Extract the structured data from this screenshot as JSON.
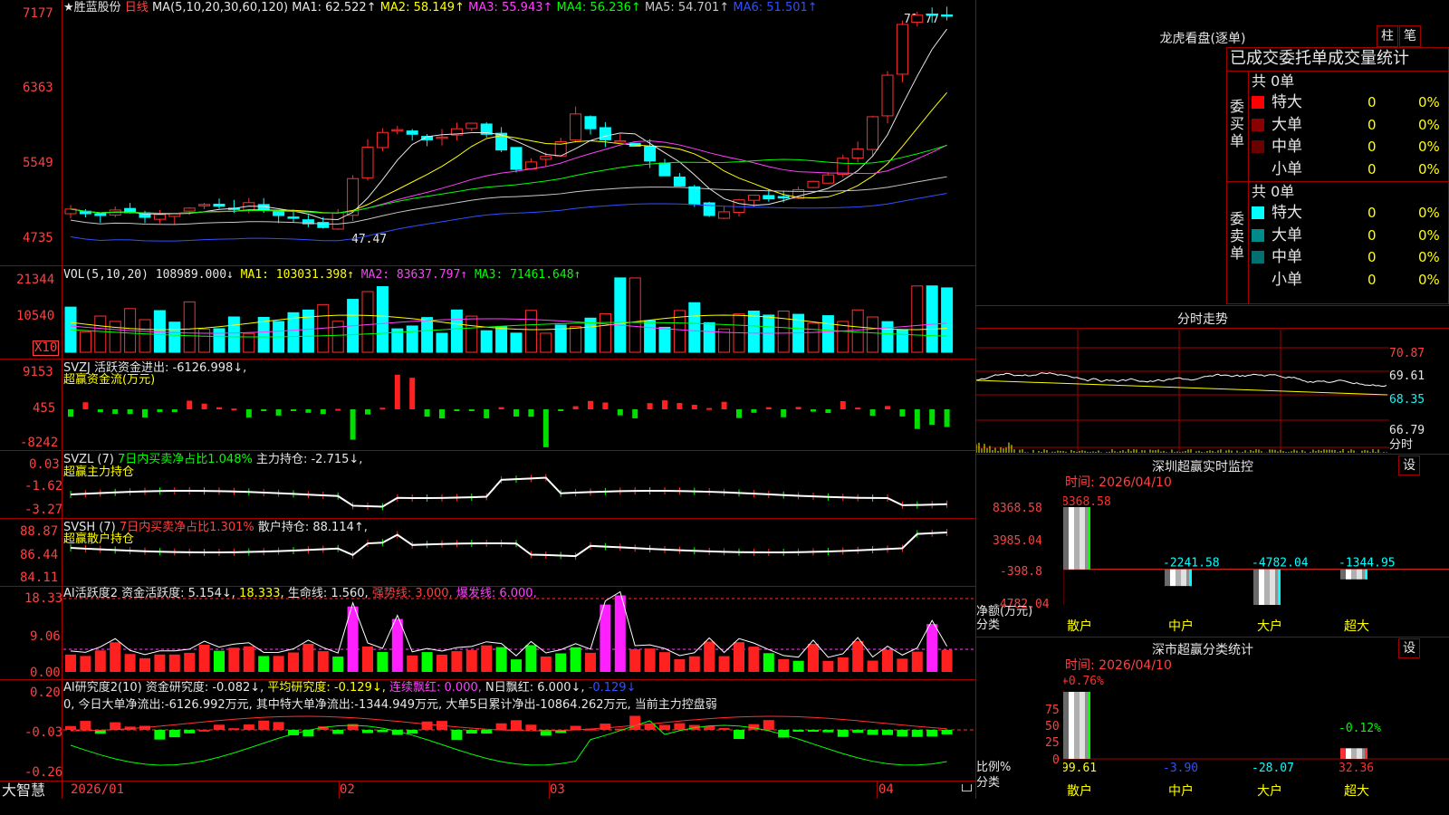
{
  "main": {
    "stock_name": "★胜蓝股份",
    "period": "日线",
    "ma_params": "MA(5,10,20,30,60,120)",
    "ma": [
      {
        "label": "MA1: 62.522↑",
        "color": "#e6e6e6"
      },
      {
        "label": "MA2: 58.149↑",
        "color": "#ffff00"
      },
      {
        "label": "MA3: 55.943↑",
        "color": "#ff40ff"
      },
      {
        "label": "MA4: 56.236↑",
        "color": "#00ff00"
      },
      {
        "label": "MA5: 54.701↑",
        "color": "#c8c8c8"
      },
      {
        "label": "MA6: 51.501↑",
        "color": "#3050ff"
      }
    ],
    "y_ticks": [
      "7177",
      "6363",
      "5549",
      "4735"
    ],
    "high_label": "71.77",
    "low_label": "47.47"
  },
  "vol": {
    "params": "VOL(5,10,20)",
    "value": "108989.000↓",
    "ma": [
      {
        "label": "MA1: 103031.398↑",
        "color": "#ffff00"
      },
      {
        "label": "MA2: 83637.797↑",
        "color": "#ff40ff"
      },
      {
        "label": "MA3: 71461.648↑",
        "color": "#00ff00"
      }
    ],
    "y_ticks": [
      "21344",
      "10540"
    ],
    "unit": "X10"
  },
  "svzj": {
    "name": "SVZJ",
    "label": "活跃资金进出: -6126.998↓,",
    "sub": "超赢资金流(万元)",
    "y_ticks": [
      "9153",
      "455",
      "-8242"
    ]
  },
  "svzl": {
    "name": "SVZL (7)",
    "l1": "7日内买卖净占比1.048%",
    "l2": "主力持仓: -2.715↓,",
    "sub": "超赢主力持仓",
    "y_ticks": [
      "0.03",
      "-1.62",
      "-3.27"
    ]
  },
  "svsh": {
    "name": "SVSH (7)",
    "l1": "7日内买卖净占比1.301%",
    "l2": "散户持仓: 88.114↑,",
    "sub": "超赢散户持仓",
    "y_ticks": [
      "88.87",
      "86.44",
      "84.11"
    ]
  },
  "ai1": {
    "name": "AI活跃度2",
    "a": "资金活跃度: 5.154↓,",
    "b": "18.333,",
    "c": "生命线: 1.560,",
    "d": "强势线: 3.000,",
    "e": "爆发线: 6.000,",
    "y_ticks": [
      "18.33",
      "9.06",
      "0.00"
    ]
  },
  "ai2": {
    "name": "AI研究度2(10)",
    "a": "资金研究度: -0.082↓,",
    "b": "平均研究度: -0.129↓,",
    "c": "连续飘红: 0.000,",
    "d": "N日飘红: 6.000↓,",
    "e": "-0.129↓",
    "note": "0, 今日大单净流出:-6126.992万元, 其中特大单净流出:-1344.949万元, 大单5日累计净出-10864.262万元, 当前主力控盘弱",
    "y_ticks": [
      "0.20",
      "-0.03",
      "-0.26"
    ]
  },
  "footer": {
    "brand": "大智慧",
    "dates": [
      "2026/01",
      "02",
      "03",
      "04"
    ]
  },
  "right": {
    "dragon_title": "龙虎看盘(逐单)",
    "tab_bar": "柱",
    "tab_tick": "笔",
    "order_header": "已成交委托单成交量统计",
    "buy_total": "共 0单",
    "buy_label": "委买单",
    "sell_total": "共 0单",
    "sell_label": "委卖单",
    "buy_rows": [
      {
        "name": "特大",
        "val": "0",
        "pct": "0%",
        "color": "#ff0000"
      },
      {
        "name": "大单",
        "val": "0",
        "pct": "0%",
        "color": "#8b0000"
      },
      {
        "name": "中单",
        "val": "0",
        "pct": "0%",
        "color": "#6b0000"
      },
      {
        "name": "小单",
        "val": "0",
        "pct": "0%",
        "color": ""
      }
    ],
    "sell_rows": [
      {
        "name": "特大",
        "val": "0",
        "pct": "0%",
        "color": "#00ffff"
      },
      {
        "name": "大单",
        "val": "0",
        "pct": "0%",
        "color": "#008b8b"
      },
      {
        "name": "中单",
        "val": "0",
        "pct": "0%",
        "color": "#007070"
      },
      {
        "name": "小单",
        "val": "0",
        "pct": "0%",
        "color": ""
      }
    ],
    "intraday_title": "分时走势",
    "intraday_ticks": [
      "70.87",
      "69.61",
      "68.35",
      "66.79"
    ],
    "intraday_bottom": "分时",
    "monitor_title": "深圳超赢实时监控",
    "settings": "设",
    "monitor_time": "时间: 2026/04/10",
    "monitor_ticks": [
      "8368.58",
      "3985.04",
      "-398.8",
      "-4782.04"
    ],
    "monitor_unit": "净额(万元)",
    "monitor_cat_label": "分类",
    "classify_title": "深市超赢分类统计",
    "classify_time": "时间: 2026/04/10",
    "classify_ticks": [
      "75",
      "50",
      "25",
      "0"
    ],
    "classify_unit": "比例%",
    "classify_cat_label": "分类",
    "categories": [
      "散户",
      "中户",
      "大户",
      "超大"
    ]
  },
  "chart_data": [
    {
      "type": "bar",
      "title": "深圳超赢实时监控",
      "ylabel": "净额(万元)",
      "categories": [
        "散户",
        "中户",
        "大户",
        "超大"
      ],
      "values": [
        8368.58,
        -2241.58,
        -4782.04,
        -1344.95
      ],
      "labels": [
        "8368.58",
        "-2241.58",
        "-4782.04",
        "-1344.95"
      ],
      "ylim": [
        -4782.04,
        8368.58
      ]
    },
    {
      "type": "bar",
      "title": "深市超赢分类统计",
      "ylabel": "比例%",
      "categories": [
        "散户",
        "中户",
        "大户",
        "超大"
      ],
      "bar_values": [
        0.76,
        0,
        0,
        -0.12
      ],
      "bar_labels": [
        "+0.76%",
        "",
        "",
        "-0.12%"
      ],
      "values": [
        99.61,
        -3.9,
        -28.07,
        32.36
      ],
      "labels": [
        "99.61",
        "-3.90",
        "-28.07",
        "32.36"
      ],
      "ylim": [
        0,
        75
      ]
    }
  ]
}
